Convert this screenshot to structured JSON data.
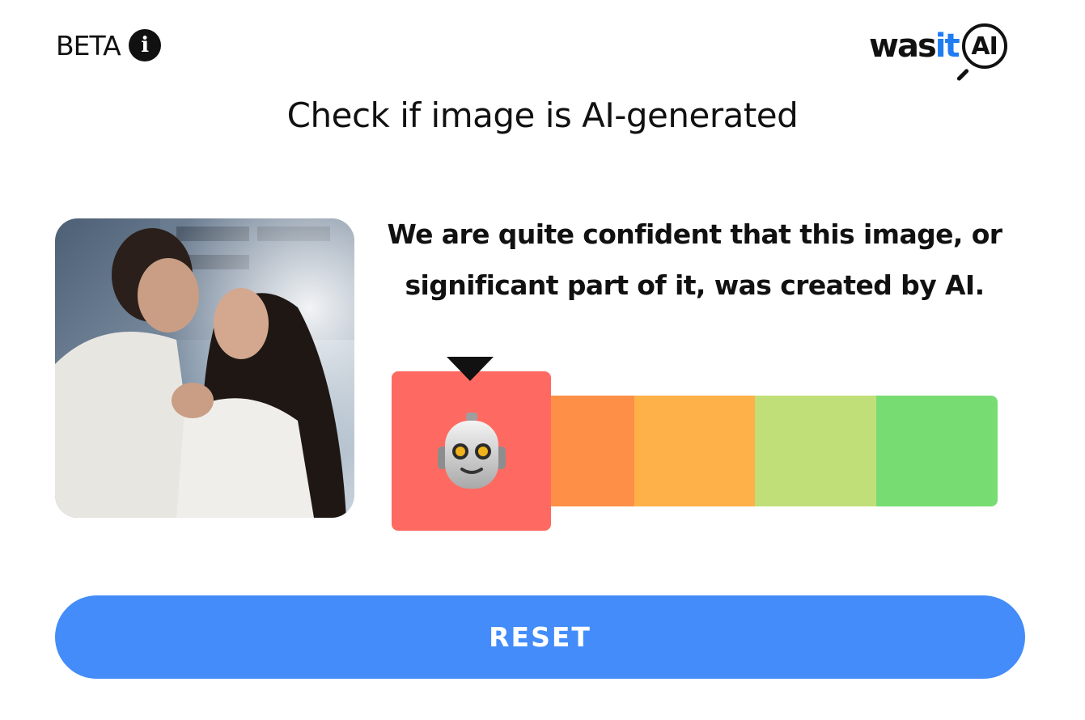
{
  "header": {
    "beta_label": "BETA",
    "info_icon": "info-icon",
    "logo": {
      "was": "was",
      "it": "it",
      "ai": "AI"
    }
  },
  "title": "Check if image is AI-generated",
  "result": {
    "verdict": "We are quite confident that this image, or significant part of it, was created by AI.",
    "meter": {
      "levels": 5,
      "selected_level": 1,
      "segment_colors": [
        "#fe6a61",
        "#fe8f46",
        "#ffb149",
        "#c1df79",
        "#77dd72"
      ],
      "indicator_icon": "robot-face-icon"
    }
  },
  "actions": {
    "reset_label": "RESET"
  },
  "colors": {
    "accent": "#438cf9",
    "logo_it": "#1f7cf3",
    "text": "#111111"
  }
}
